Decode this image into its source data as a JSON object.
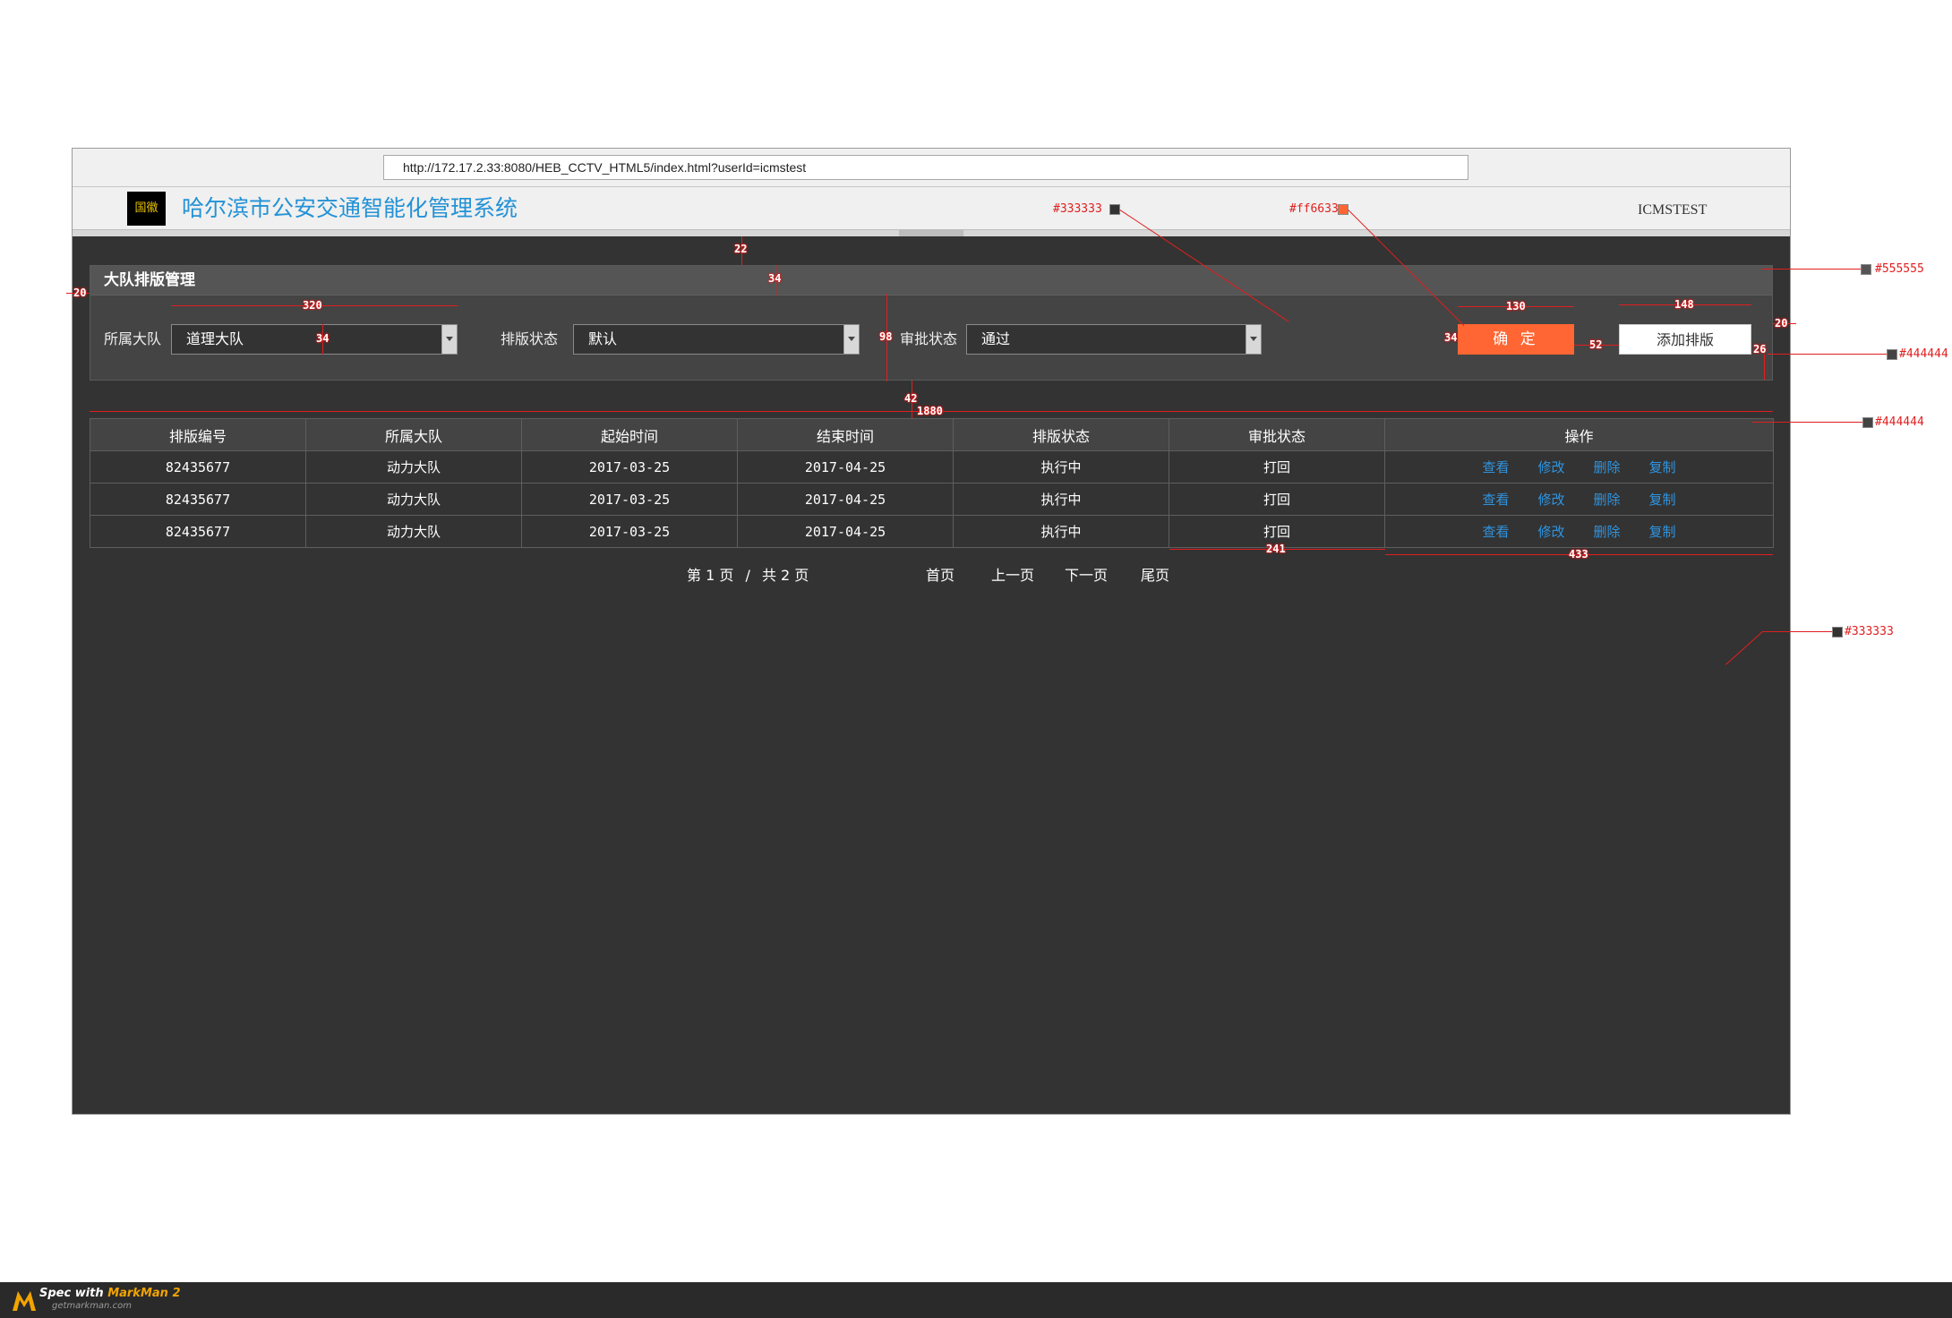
{
  "browser": {
    "url": "http://172.17.2.33:8080/HEB_CCTV_HTML5/index.html?userId=icmstest"
  },
  "header": {
    "emblem_label": "国徽",
    "title": "哈尔滨市公安交通智能化管理系统",
    "user": "ICMSTEST"
  },
  "panel": {
    "title": "大队排版管理",
    "filters": [
      {
        "label": "所属大队",
        "value": "道理大队"
      },
      {
        "label": "排版状态",
        "value": "默认"
      },
      {
        "label": "审批状态",
        "value": "通过"
      }
    ],
    "confirm_label": "确 定",
    "add_label": "添加排版"
  },
  "table": {
    "headers": [
      "排版编号",
      "所属大队",
      "起始时间",
      "结束时间",
      "排版状态",
      "审批状态",
      "操作"
    ],
    "rows": [
      {
        "id": "82435677",
        "team": "动力大队",
        "start": "2017-03-25",
        "end": "2017-04-25",
        "status": "执行中",
        "approval": "打回"
      },
      {
        "id": "82435677",
        "team": "动力大队",
        "start": "2017-03-25",
        "end": "2017-04-25",
        "status": "执行中",
        "approval": "打回"
      },
      {
        "id": "82435677",
        "team": "动力大队",
        "start": "2017-03-25",
        "end": "2017-04-25",
        "status": "执行中",
        "approval": "打回"
      }
    ],
    "actions": [
      "查看",
      "修改",
      "删除",
      "复制"
    ]
  },
  "pagination": {
    "current": "第 1 页",
    "separator": "/",
    "total": "共 2 页",
    "first": "首页",
    "prev": "上一页",
    "next": "下一页",
    "last": "尾页"
  },
  "annotations": {
    "colors": {
      "c333333": "#333333",
      "cff6633": "#ff6633",
      "c555555": "#555555",
      "c444444a": "#444444",
      "c444444b": "#444444",
      "c333333b": "#333333"
    },
    "dims": {
      "d22": "22",
      "d34a": "34",
      "d20a": "20",
      "d320": "320",
      "d34b": "34",
      "d98": "98",
      "d130": "130",
      "d148": "148",
      "d20b": "20",
      "d34c": "34",
      "d52": "52",
      "d26": "26",
      "d42": "42",
      "d1880": "1880",
      "d241": "241",
      "d433": "433"
    }
  },
  "footer": {
    "spec_prefix": "Spec with ",
    "brand": "MarkMan 2",
    "site": "getmarkman.com"
  }
}
